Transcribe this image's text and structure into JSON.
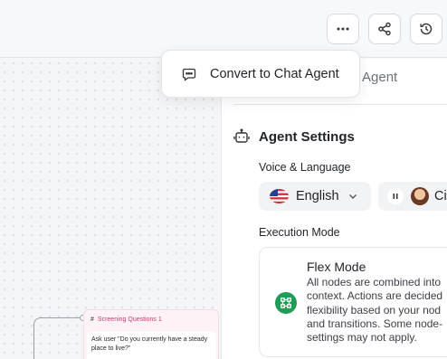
{
  "menu": {
    "convert_label": "Convert to Chat Agent"
  },
  "panel": {
    "tab_partial_label": "st Agent",
    "agent_settings_label": "Agent Settings",
    "voice_language_label": "Voice & Language",
    "language_value": "English",
    "voice_partial_value": "Ci",
    "execution_mode_label": "Execution Mode",
    "flex_mode": {
      "title": "Flex Mode",
      "description_lines": [
        "All nodes are combined into",
        "context. Actions are decided",
        "flexibility based on your nod",
        "and transitions. Some node-",
        "settings may not apply."
      ]
    }
  },
  "canvas": {
    "node": {
      "hash": "#",
      "title": "Screening Questions 1",
      "body": "Ask user \"Do you currently have a steady place to live?\""
    }
  },
  "colors": {
    "accent_green": "#1f9d58",
    "node_pink": "#c53b71"
  },
  "icons": {
    "more": "more-horizontal-icon",
    "share": "share-icon",
    "history": "history-icon",
    "chat": "chat-bubble-icon",
    "robot": "robot-icon",
    "flag": "us-flag-icon",
    "chevron": "chevron-down-icon",
    "pause": "pause-icon",
    "flex": "flex-mode-icon"
  }
}
